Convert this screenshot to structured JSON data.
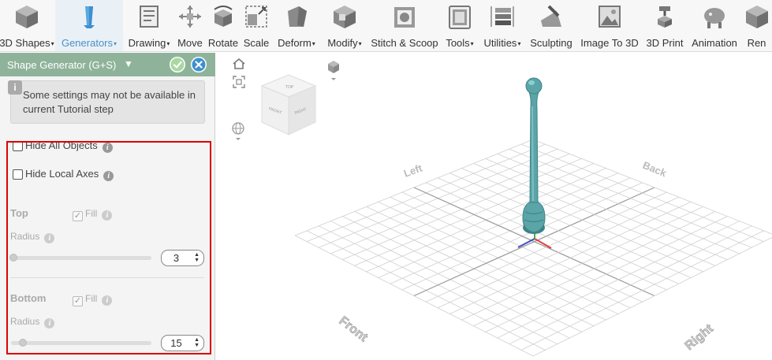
{
  "toolbar": {
    "items": [
      {
        "label": "3D Shapes",
        "icon": "cube-icon",
        "dropdown": true
      },
      {
        "label": "Generators",
        "icon": "generator-icon",
        "dropdown": true,
        "active": true
      },
      {
        "label": "Drawing",
        "icon": "drawing-icon",
        "dropdown": true
      },
      {
        "label": "Move",
        "icon": "move-icon",
        "dropdown": false
      },
      {
        "label": "Rotate",
        "icon": "rotate-icon",
        "dropdown": false
      },
      {
        "label": "Scale",
        "icon": "scale-icon",
        "dropdown": false
      },
      {
        "label": "Deform",
        "icon": "deform-icon",
        "dropdown": true
      },
      {
        "label": "Modify",
        "icon": "modify-icon",
        "dropdown": true
      },
      {
        "label": "Stitch & Scoop",
        "icon": "stitch-scoop-icon",
        "dropdown": false
      },
      {
        "label": "Tools",
        "icon": "tools-icon",
        "dropdown": true
      },
      {
        "label": "Utilities",
        "icon": "utilities-icon",
        "dropdown": true
      },
      {
        "label": "Sculpting",
        "icon": "sculpting-icon",
        "dropdown": false
      },
      {
        "label": "Image To 3D",
        "icon": "image-to-3d-icon",
        "dropdown": false
      },
      {
        "label": "3D Print",
        "icon": "3d-print-icon",
        "dropdown": false
      },
      {
        "label": "Animation",
        "icon": "animation-icon",
        "dropdown": false
      },
      {
        "label": "Ren",
        "icon": "render-icon",
        "dropdown": false
      }
    ]
  },
  "panel": {
    "title": "Shape Generator (G+S)",
    "notice": "Some settings may not be available in current Tutorial step",
    "hide_all_objects": "Hide All Objects",
    "hide_local_axes": "Hide Local Axes",
    "top": {
      "title": "Top",
      "fill_label": "Fill",
      "radius_label": "Radius",
      "radius_value": "3",
      "fill_checked": true
    },
    "bottom": {
      "title": "Bottom",
      "fill_label": "Fill",
      "radius_label": "Radius",
      "radius_value": "15",
      "fill_checked": true
    }
  },
  "viewport": {
    "grid_labels": {
      "left": "Left",
      "back": "Back",
      "front": "Front",
      "right": "Right"
    },
    "view_cube": {
      "top": "TOP",
      "front": "FRONT",
      "right": "RIGHT"
    }
  },
  "colors": {
    "accent": "#4a90c8",
    "panel_header": "#8fb39a",
    "highlight": "#dd0000",
    "shape": "#5ba4a8"
  }
}
